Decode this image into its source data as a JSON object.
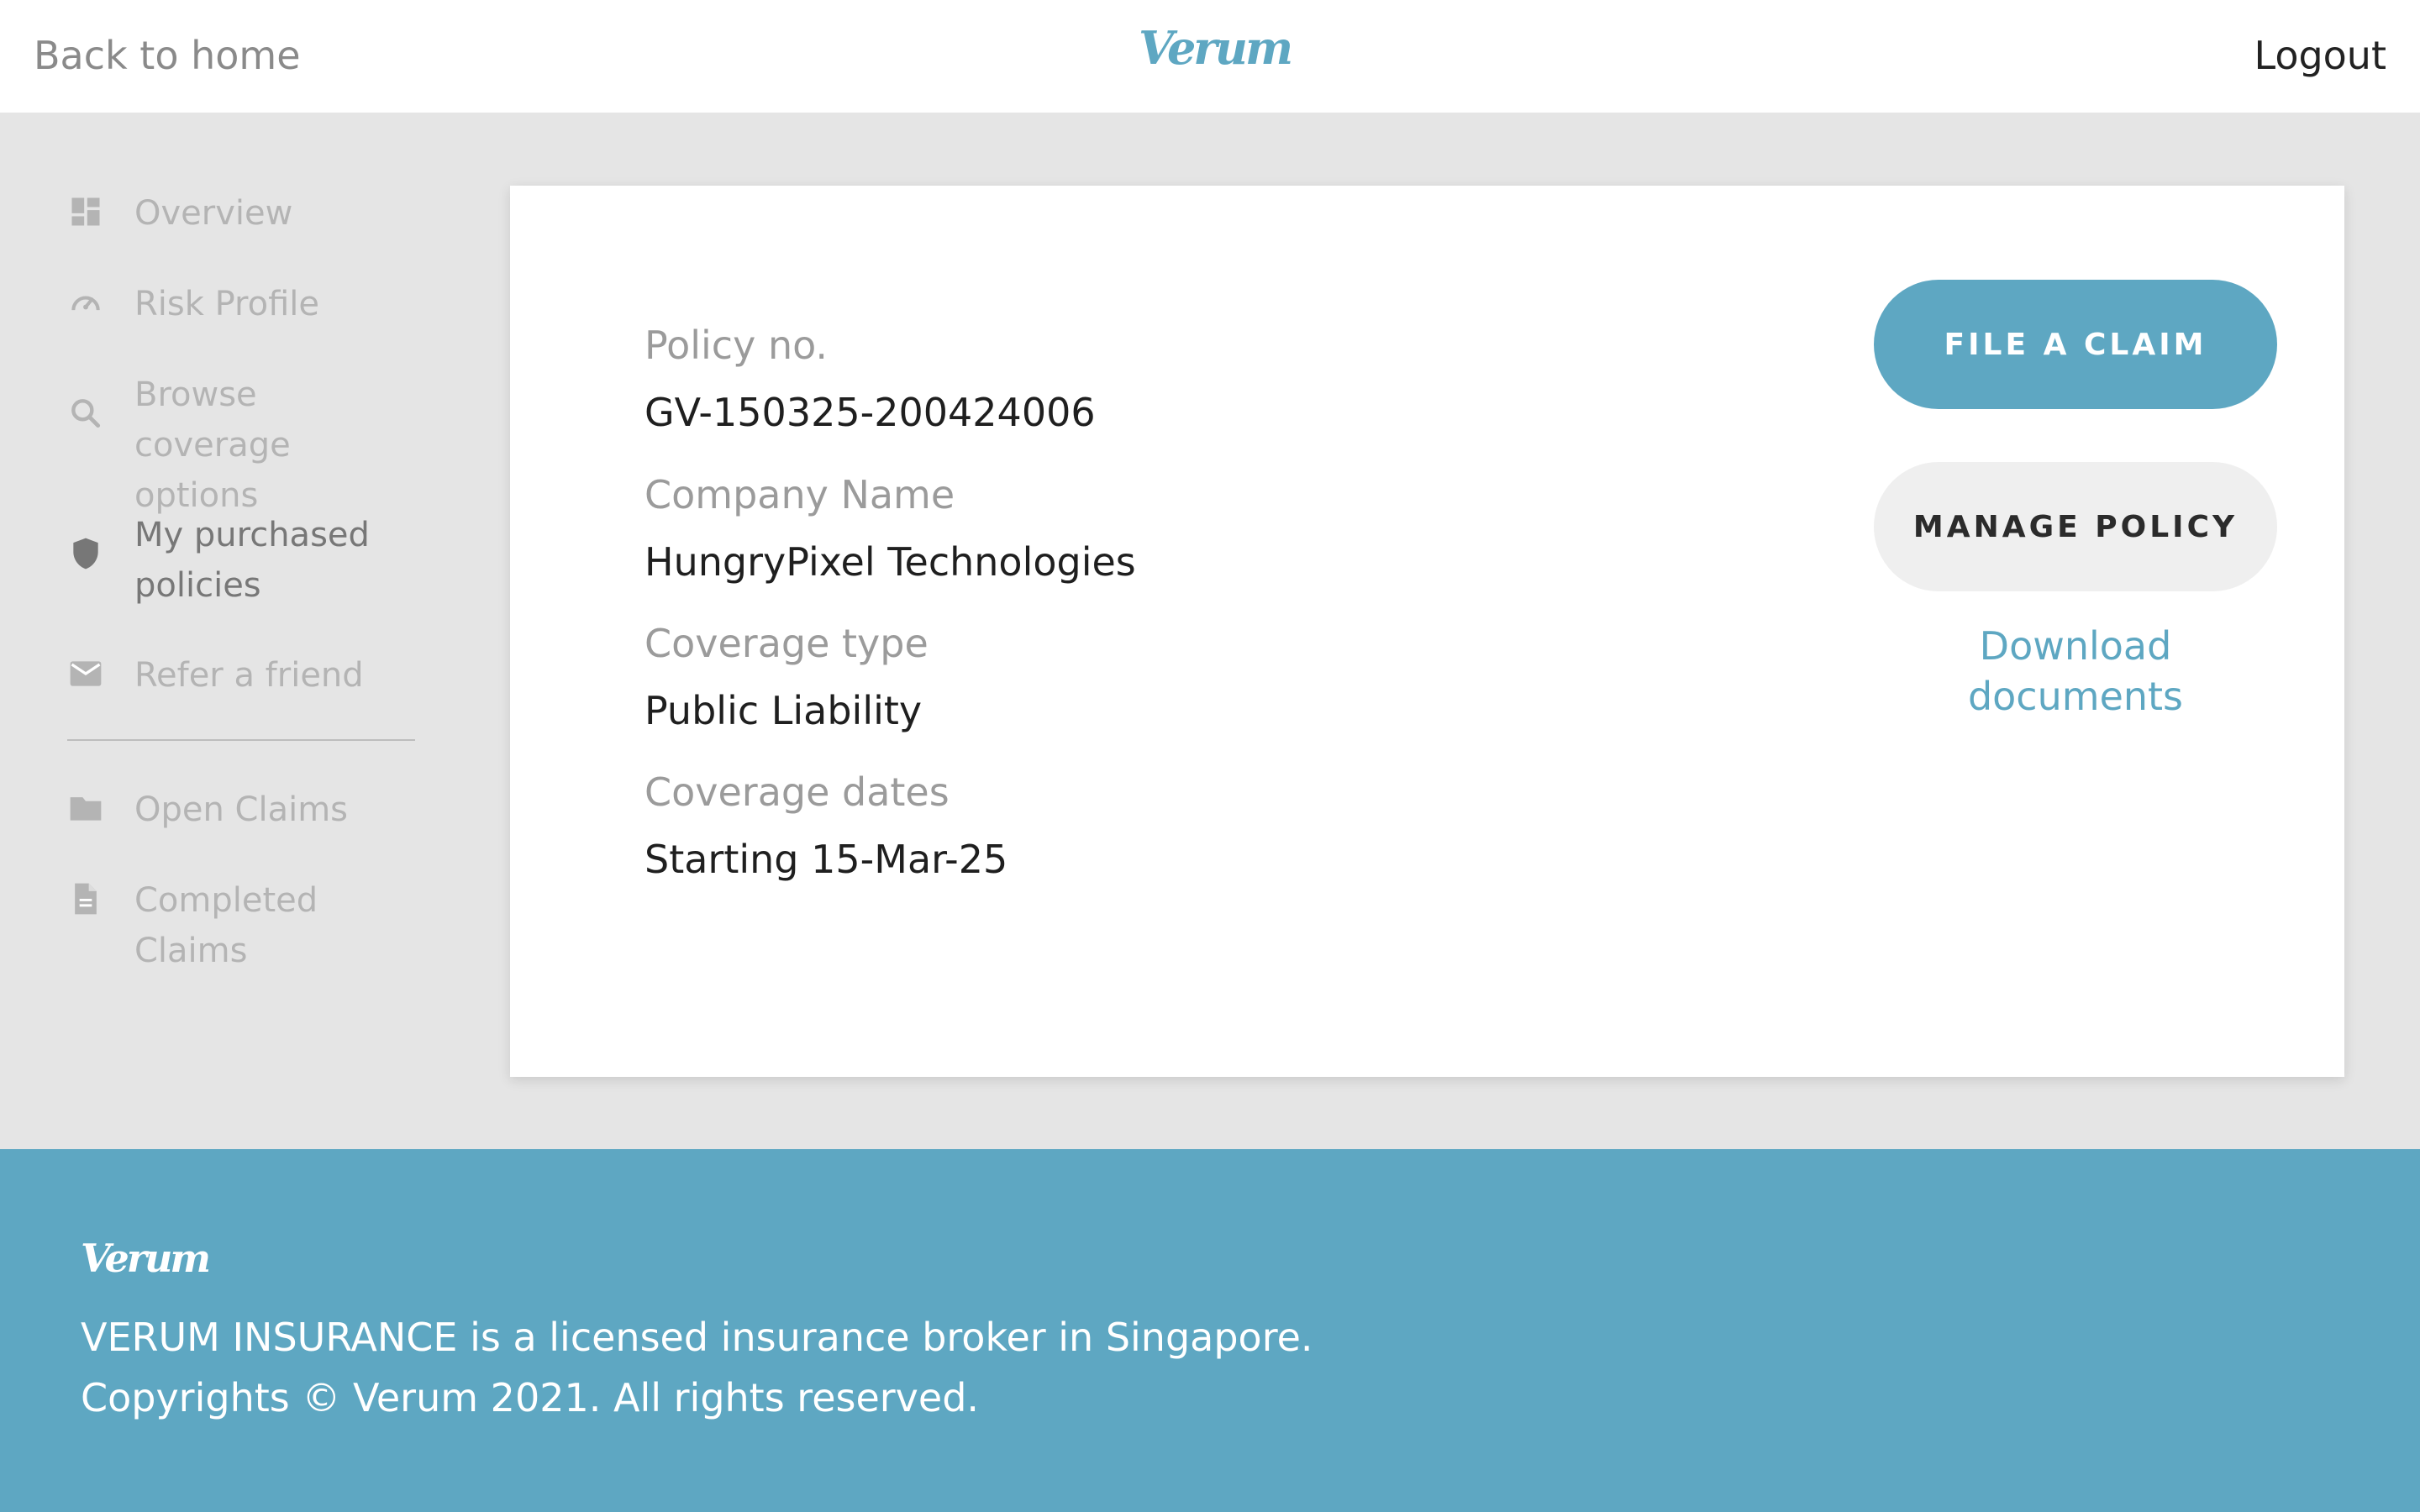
{
  "header": {
    "back_label": "Back to home",
    "logo_text": "Verum",
    "logout_label": "Logout"
  },
  "sidebar": {
    "items": [
      {
        "label": "Overview",
        "icon": "dashboard-icon"
      },
      {
        "label": "Risk Profile",
        "icon": "speedometer-icon"
      },
      {
        "label": "Browse coverage options",
        "icon": "search-icon"
      },
      {
        "label": "My purchased policies",
        "icon": "shield-icon",
        "active": true
      },
      {
        "label": "Refer a friend",
        "icon": "mail-icon"
      }
    ],
    "claims": [
      {
        "label": "Open Claims",
        "icon": "folder-icon"
      },
      {
        "label": "Completed Claims",
        "icon": "document-icon"
      }
    ]
  },
  "policy": {
    "policy_no_label": "Policy no.",
    "policy_no": "GV-150325-200424006",
    "company_label": "Company Name",
    "company": "HungryPixel Technologies",
    "coverage_type_label": "Coverage type",
    "coverage_type": "Public Liability",
    "coverage_dates_label": "Coverage dates",
    "coverage_dates": "Starting 15-Mar-25"
  },
  "actions": {
    "file_claim": "FILE A CLAIM",
    "manage_policy": "MANAGE POLICY",
    "download": "Download documents"
  },
  "footer": {
    "logo_text": "Verum",
    "line1": "VERUM INSURANCE is a licensed insurance broker in Singapore.",
    "line2": "Copyrights © Verum 2021. All rights reserved."
  },
  "colors": {
    "brand": "#5ea7c2",
    "background": "#e5e5e5",
    "muted": "#b4b4b4"
  }
}
